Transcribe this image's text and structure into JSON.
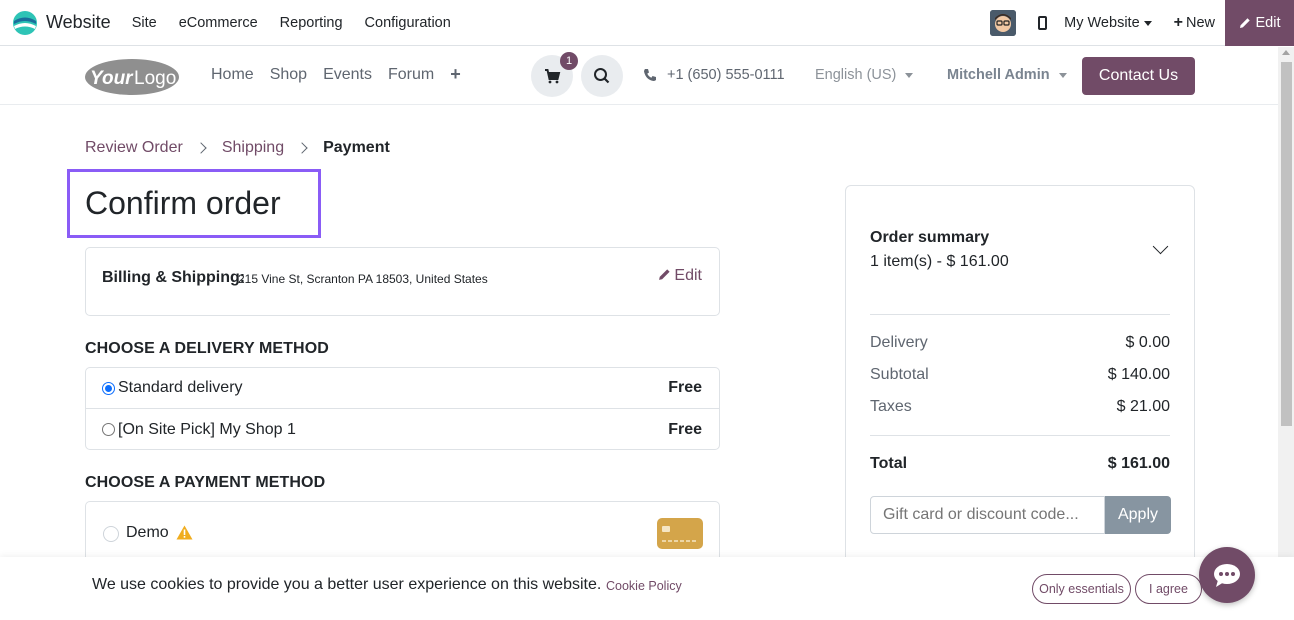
{
  "adminbar": {
    "app_name": "Website",
    "menu": [
      "Site",
      "eCommerce",
      "Reporting",
      "Configuration"
    ],
    "website_switcher": "My Website",
    "new_label": "New",
    "edit_label": "Edit",
    "brand_color": "#714b67"
  },
  "header": {
    "logo_text": "YourLogo",
    "nav": [
      "Home",
      "Shop",
      "Events",
      "Forum"
    ],
    "cart_count": "1",
    "phone": "+1 (650) 555-0111",
    "language": "English (US)",
    "user": "Mitchell Admin",
    "contact_label": "Contact Us"
  },
  "breadcrumb": {
    "steps": [
      "Review Order",
      "Shipping",
      "Payment"
    ],
    "active_index": 2
  },
  "page": {
    "title": "Confirm order"
  },
  "billing": {
    "label": "Billing & Shipping:",
    "address": "215 Vine St, Scranton PA 18503, United States",
    "edit_label": "Edit"
  },
  "delivery": {
    "heading": "CHOOSE A DELIVERY METHOD",
    "options": [
      {
        "name": "Standard delivery",
        "price": "Free",
        "selected": true
      },
      {
        "name": "[On Site Pick] My Shop 1",
        "price": "Free",
        "selected": false
      }
    ]
  },
  "payment": {
    "heading": "CHOOSE A PAYMENT METHOD",
    "options": [
      {
        "name": "Demo",
        "icon": "warning-icon",
        "selected": false
      }
    ]
  },
  "summary": {
    "heading": "Order summary",
    "items_line": "1 item(s) -  $ 161.00",
    "rows": [
      {
        "label": "Delivery",
        "value": "$ 0.00"
      },
      {
        "label": "Subtotal",
        "value": "$ 140.00"
      },
      {
        "label": "Taxes",
        "value": "$ 21.00"
      }
    ],
    "total_label": "Total",
    "total_value": "$ 161.00",
    "coupon_placeholder": "Gift card or discount code...",
    "apply_label": "Apply"
  },
  "cookies": {
    "message": "We use cookies to provide you a better user experience on this website.",
    "policy_link": "Cookie Policy",
    "essentials_label": "Only essentials",
    "agree_label": "I agree"
  }
}
